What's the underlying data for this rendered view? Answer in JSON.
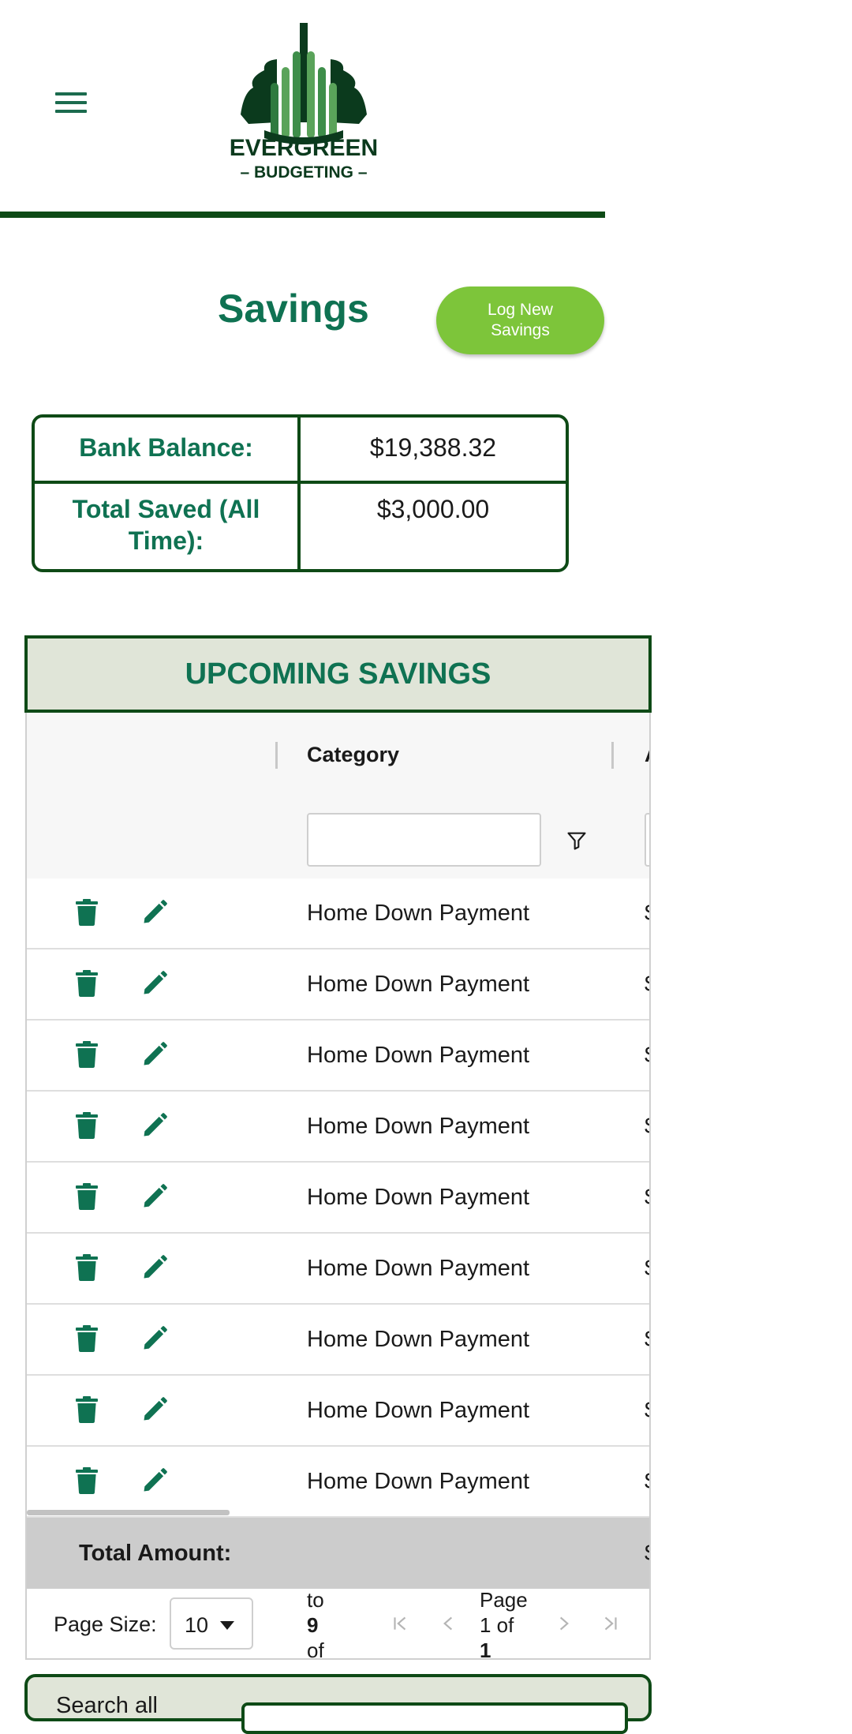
{
  "header": {
    "logo_brand": "EVERGREEN",
    "logo_sub": "– BUDGETING –"
  },
  "page": {
    "title": "Savings",
    "log_button": "Log New Savings"
  },
  "summary": {
    "bank_balance_label": "Bank Balance:",
    "bank_balance_value": "$19,388.32",
    "total_saved_label": "Total Saved (All Time):",
    "total_saved_value": "$3,000.00"
  },
  "upcoming": {
    "heading": "UPCOMING SAVINGS",
    "columns": [
      "",
      "Category",
      "A"
    ],
    "rows": [
      {
        "category": "Home Down Payment",
        "amount": "$"
      },
      {
        "category": "Home Down Payment",
        "amount": "$"
      },
      {
        "category": "Home Down Payment",
        "amount": "$"
      },
      {
        "category": "Home Down Payment",
        "amount": "$"
      },
      {
        "category": "Home Down Payment",
        "amount": "$"
      },
      {
        "category": "Home Down Payment",
        "amount": "$"
      },
      {
        "category": "Home Down Payment",
        "amount": "$"
      },
      {
        "category": "Home Down Payment",
        "amount": "$"
      },
      {
        "category": "Home Down Payment",
        "amount": "$"
      }
    ],
    "total_label": "Total Amount:",
    "total_value": "$",
    "pager": {
      "page_size_label": "Page Size:",
      "page_size_value": "10",
      "count_line1": "to",
      "count_line2": "9",
      "count_line3": "of",
      "page_line1": "Page",
      "page_line2": "1 of",
      "page_line3": "1"
    }
  },
  "search": {
    "label": "Search all"
  },
  "colors": {
    "brand_green": "#0f7252",
    "dark_green": "#0e4a16",
    "button_green": "#7dc53a",
    "section_bg": "#e0e5d8"
  }
}
